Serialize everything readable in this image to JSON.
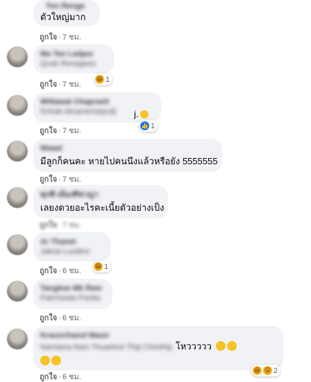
{
  "comments": [
    {
      "name": "Ton Renge",
      "text": "ตัวใหญ่มาก",
      "like": "ถูกใจ",
      "time": "7 ชม."
    },
    {
      "name": "Ma Tee Ladpor",
      "name2": "Quak Renagaoo",
      "like": "ถูกใจ",
      "time": "7 ชม.",
      "reaction_count": "1"
    },
    {
      "name": "Wittawat Chaprasit",
      "name2": "Dnhak Aksarachaiyudj",
      "text": "",
      "like": "ถูกใจ",
      "time": "7 ชม.",
      "reaction_count": "1"
    },
    {
      "name": "Waaal",
      "text": "มีลูกก็คนคะ หายไปคนนึงแล้วหรือยัง 5555555",
      "like": "ถูกใจ",
      "time": "7 ชม."
    },
    {
      "name": "พุกพี เมืองทิชาญา",
      "text": "เลยงดวยอะไรคะเนี้ยตัวอย่างเป็ง",
      "like": "ถูกใจ",
      "time": "7 ชม."
    },
    {
      "name": "Ar Thanet",
      "name2": "Jakrat Lusdinn",
      "like": "ถูกใจ",
      "time": "6 ชม.",
      "reaction_count": "1"
    },
    {
      "name": "Tangkee Mk Reer",
      "name2": "Patchanee Panke",
      "like": "ถูกใจ",
      "time": "6 ชม."
    },
    {
      "name": "Kraunchanol Maun",
      "name2": "Namtana Nam Thuarbort Thip Chorthip",
      "text": "โหววววว",
      "like": "ถูกใจ",
      "time": "6 ชม.",
      "reaction_count": "2"
    }
  ],
  "separator": "·"
}
